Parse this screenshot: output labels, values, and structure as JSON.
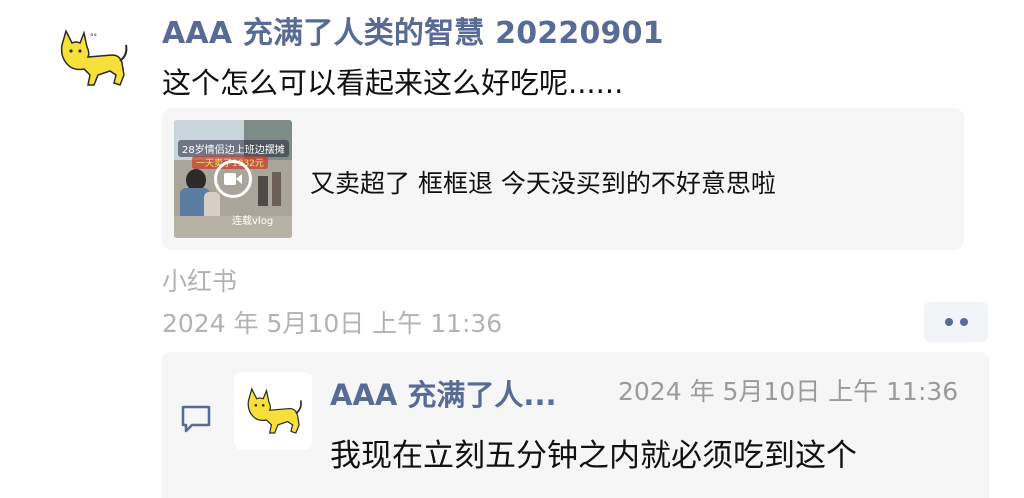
{
  "post": {
    "author": "AAA 充满了人类的智慧 20220901",
    "avatar_icon": "yellow-cat-icon",
    "text": "这个怎么可以看起来这么好吃呢......",
    "link_card": {
      "thumbnail_caption": "28岁情侣边上班边摆摊",
      "thumbnail_subcaption": "一天卖了1032元",
      "thumbnail_tag": "连载vlog",
      "thumbnail_icon": "video-play-icon",
      "title": "又卖超了 框框退 今天没买到的不好意思啦"
    },
    "source": "小红书",
    "timestamp": "2024 年 5月10日 上午 11:36",
    "more_icon": "more-dots-icon"
  },
  "comments": {
    "icon": "comment-icon",
    "items": [
      {
        "author": "AAA 充满了人...",
        "avatar_icon": "yellow-cat-icon",
        "time": "2024 年 5月10日 上午 11:36",
        "text": "我现在立刻五分钟之内就必须吃到这个"
      }
    ]
  },
  "colors": {
    "link_blue": "#576b95",
    "meta_gray": "#b2b2b2",
    "card_bg": "#f6f6f6",
    "cat_yellow": "#f7e03a"
  }
}
